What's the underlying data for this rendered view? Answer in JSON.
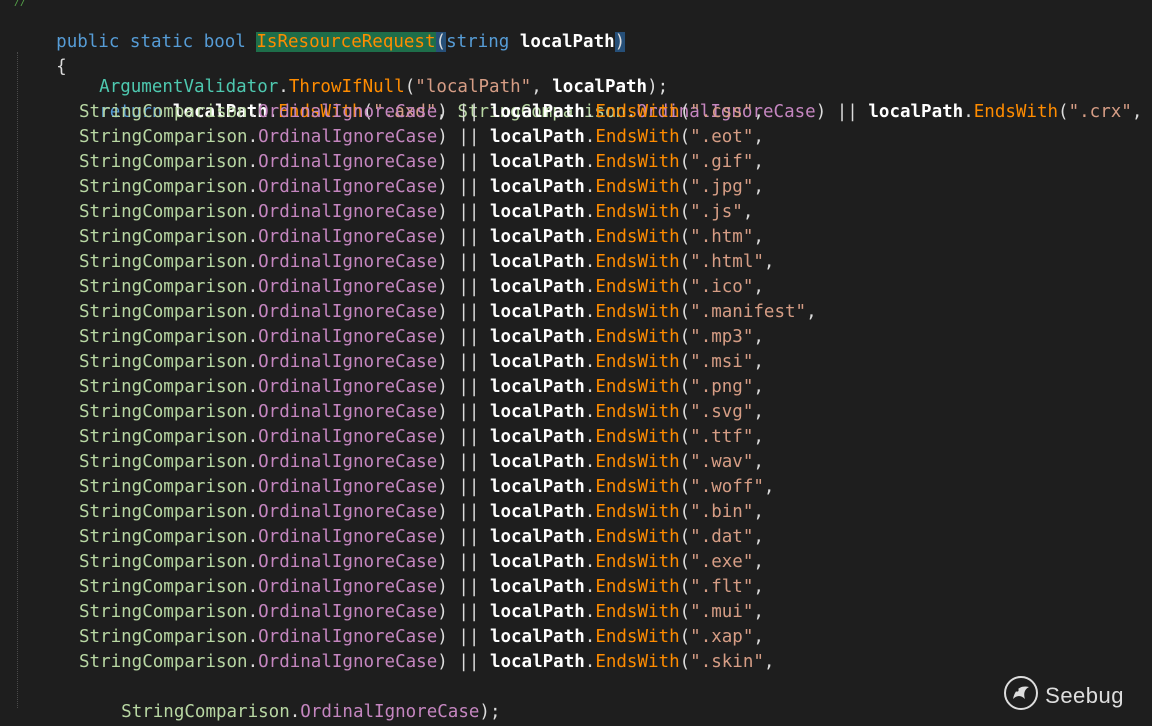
{
  "editor": {
    "top_stub": "//",
    "method_signature": {
      "kw_public": "public",
      "kw_static": "static",
      "kw_bool": "bool",
      "method_name": "IsResourceRequest",
      "open_paren": "(",
      "kw_string": "string",
      "param_name": "localPath",
      "close_paren": ")"
    },
    "open_brace": "{",
    "validator_line": {
      "class_name": "ArgumentValidator",
      "dot": ".",
      "method": "ThrowIfNull",
      "open": "(",
      "arg_string": "\"localPath\"",
      "comma": ", ",
      "arg_param": "localPath",
      "close": ");"
    },
    "return_line": {
      "kw_return": "return",
      "param_a": "localPath",
      "dot_a": ".",
      "method_a": "EndsWith",
      "open_a": "(",
      "ext_a": "\".axd\"",
      "comma_a": ", ",
      "enum_a": "StringComparison",
      "dot_enum_a": ".",
      "member_a": "OrdinalIgnoreCase",
      "close_or_a": ") || ",
      "param_b": "localPath",
      "dot_b": ".",
      "method_b": "EndsWith",
      "open_b": "(",
      "ext_b": "\".crx\"",
      "comma_b": ","
    },
    "enum_name": "StringComparison",
    "enum_member": "OrdinalIgnoreCase",
    "or_sep": ") || ",
    "param_name": "localPath",
    "endswith": "EndsWith",
    "extensions": [
      "\".css\"",
      "\".eot\"",
      "\".gif\"",
      "\".jpg\"",
      "\".js\"",
      "\".htm\"",
      "\".html\"",
      "\".ico\"",
      "\".manifest\"",
      "\".mp3\"",
      "\".msi\"",
      "\".png\"",
      "\".svg\"",
      "\".ttf\"",
      "\".wav\"",
      "\".woff\"",
      "\".bin\"",
      "\".dat\"",
      "\".exe\"",
      "\".flt\"",
      "\".mui\"",
      "\".xap\"",
      "\".skin\""
    ],
    "final_terminator": ");",
    "close_brace": "}"
  },
  "watermark": {
    "brand": "Seebug",
    "icon": "seebug-logo-icon"
  }
}
